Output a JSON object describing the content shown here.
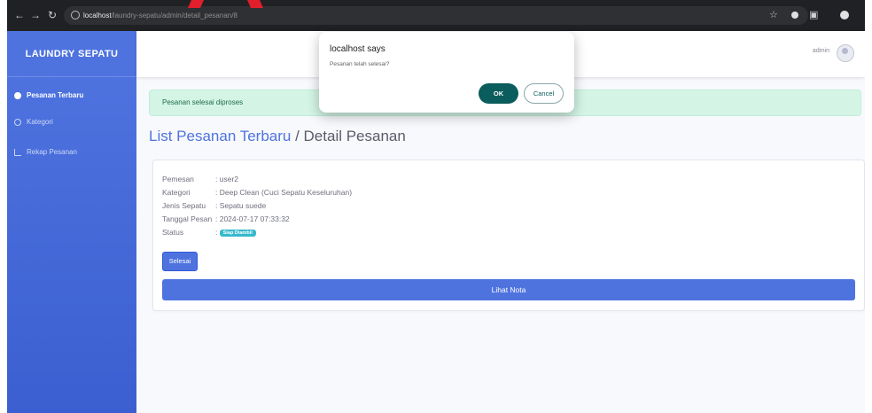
{
  "browser": {
    "url_host": "localhost",
    "url_path": "/laundry-sepatu/admin/detail_pesanan/8"
  },
  "sidebar": {
    "brand": "LAUNDRY SEPATU",
    "items": [
      {
        "label": "Pesanan Terbaru",
        "icon": "dashboard-icon",
        "active": true
      },
      {
        "label": "Kategori",
        "icon": "category-icon",
        "active": false
      },
      {
        "label": "Rekap Pesanan",
        "icon": "chart-icon",
        "active": false
      }
    ]
  },
  "topbar": {
    "user": "admin"
  },
  "alert": {
    "text": "Pesanan selesai diproses"
  },
  "heading": {
    "link": "List Pesanan Terbaru",
    "separator": " / ",
    "current": "Detail Pesanan"
  },
  "detail": {
    "rows": [
      {
        "label": "Pemesan",
        "value": ": user2"
      },
      {
        "label": "Kategori",
        "value": ": Deep Clean (Cuci Sepatu Keseluruhan)"
      },
      {
        "label": "Jenis Sepatu",
        "value": ": Sepatu suede"
      },
      {
        "label": "Tanggal Pesan",
        "value": ": 2024-07-17 07:33:32"
      },
      {
        "label": "Status",
        "value": ": "
      }
    ],
    "status_badge": "Siap Diambil",
    "status_color": "#36b9cc",
    "selesai_button": "Selesai",
    "nota_button": "Lihat Nota"
  },
  "dialog": {
    "title": "localhost says",
    "message": "Pesanan telah selesai?",
    "ok": "OK",
    "cancel": "Cancel"
  },
  "colors": {
    "primary": "#4e73df",
    "alert_bg": "#d4f5e6",
    "dialog_ok": "#0b5c5c"
  }
}
